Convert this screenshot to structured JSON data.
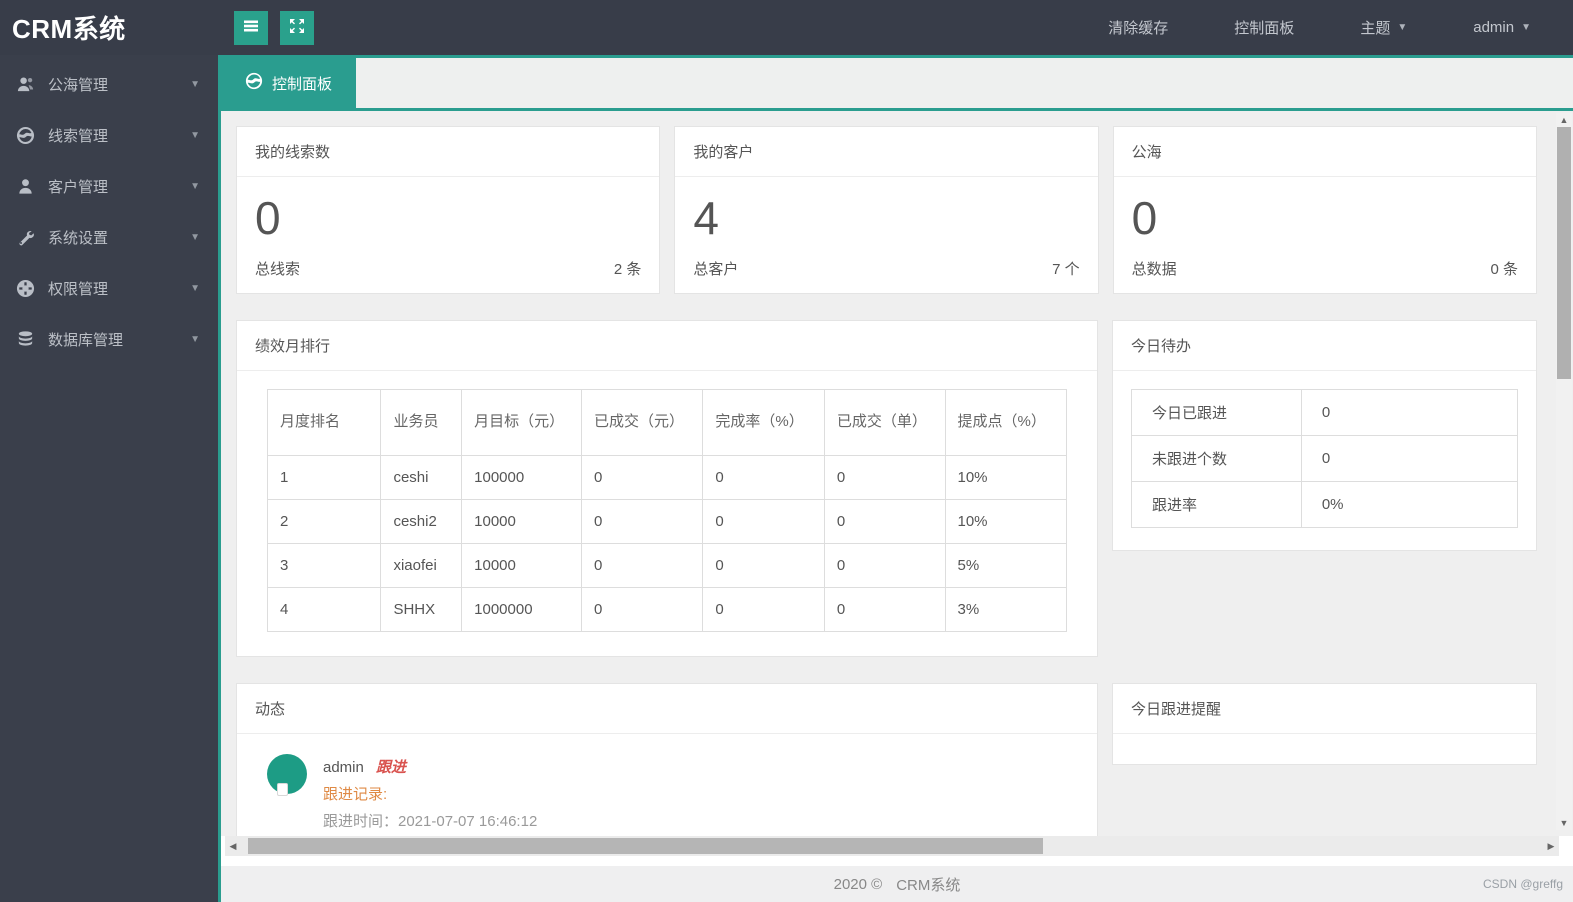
{
  "app": {
    "title": "CRM系统"
  },
  "topbar": {
    "items": [
      {
        "label": "清除缓存"
      },
      {
        "label": "控制面板"
      },
      {
        "label": "主题"
      },
      {
        "label": "admin"
      }
    ]
  },
  "sidebar": {
    "items": [
      {
        "label": "公海管理",
        "icon": "users-icon"
      },
      {
        "label": "线索管理",
        "icon": "globe-icon"
      },
      {
        "label": "客户管理",
        "icon": "user-icon"
      },
      {
        "label": "系统设置",
        "icon": "wrench-icon"
      },
      {
        "label": "权限管理",
        "icon": "permissions-icon"
      },
      {
        "label": "数据库管理",
        "icon": "database-icon"
      }
    ]
  },
  "tabs": {
    "active": {
      "label": "控制面板",
      "icon": "dashboard-globe-icon"
    }
  },
  "stat_cards": [
    {
      "title": "我的线索数",
      "value": "0",
      "footer_label": "总线索",
      "footer_value": "2 条"
    },
    {
      "title": "我的客户",
      "value": "4",
      "footer_label": "总客户",
      "footer_value": "7 个"
    },
    {
      "title": "公海",
      "value": "0",
      "footer_label": "总数据",
      "footer_value": "0 条"
    }
  ],
  "performance": {
    "title": "绩效月排行",
    "columns": [
      "月度排名",
      "业务员",
      "月目标（元）",
      "已成交（元）",
      "完成率（%）",
      "已成交（单）",
      "提成点（%）"
    ],
    "rows": [
      [
        "1",
        "ceshi",
        "100000",
        "0",
        "0",
        "0",
        "10%"
      ],
      [
        "2",
        "ceshi2",
        "10000",
        "0",
        "0",
        "0",
        "10%"
      ],
      [
        "3",
        "xiaofei",
        "10000",
        "0",
        "0",
        "0",
        "5%"
      ],
      [
        "4",
        "SHHX",
        "1000000",
        "0",
        "0",
        "0",
        "3%"
      ]
    ]
  },
  "todo": {
    "title": "今日待办",
    "rows": [
      {
        "label": "今日已跟进",
        "value": "0"
      },
      {
        "label": "未跟进个数",
        "value": "0"
      },
      {
        "label": "跟进率",
        "value": "0%"
      }
    ]
  },
  "activity": {
    "title": "动态",
    "item": {
      "user": "admin",
      "action": "跟进",
      "record_label": "跟进记录:",
      "time_text": "跟进时间：2021-07-07 16:46:12"
    }
  },
  "reminder": {
    "title": "今日跟进提醒"
  },
  "footer": {
    "year_text": "2020 ©",
    "brand": "CRM系统",
    "watermark": "CSDN @greffg"
  },
  "colors": {
    "accent_teal": "#2a9d8f",
    "topbar_dark": "#383d49",
    "sidebar_dark": "#3a3f4b",
    "content_bg": "#efefef",
    "action_red": "#d9534f",
    "record_orange": "#df8a45"
  }
}
